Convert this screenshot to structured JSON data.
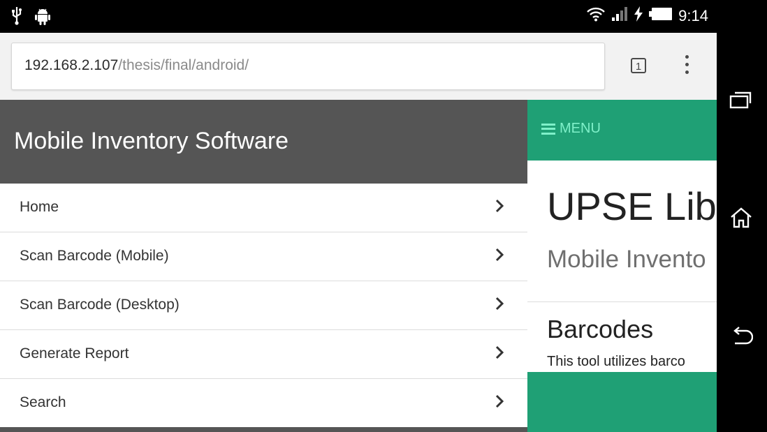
{
  "status_bar": {
    "time": "9:14",
    "left_icons": [
      "usb-icon",
      "android-icon"
    ],
    "right_icons": [
      "wifi-icon",
      "signal-icon",
      "charging-icon",
      "battery-icon"
    ]
  },
  "browser": {
    "url_host": "192.168.2.107",
    "url_path": "/thesis/final/android/",
    "tab_count": "1"
  },
  "left_panel": {
    "title": "Mobile Inventory Software",
    "items": [
      {
        "label": "Home"
      },
      {
        "label": "Scan Barcode (Mobile)"
      },
      {
        "label": "Scan Barcode (Desktop)"
      },
      {
        "label": "Generate Report"
      },
      {
        "label": "Search"
      }
    ]
  },
  "right_panel": {
    "menu_label": "MENU",
    "hero_title": "UPSE Lib",
    "hero_subtitle": "Mobile Invento",
    "section_title": "Barcodes",
    "section_text": "This tool utilizes barco"
  },
  "nav_bar": {
    "icons": [
      "recents-icon",
      "home-icon",
      "back-icon"
    ]
  },
  "colors": {
    "accent_green": "#1fa075",
    "menu_text": "#7ff0c9",
    "panel_header": "#555555"
  }
}
